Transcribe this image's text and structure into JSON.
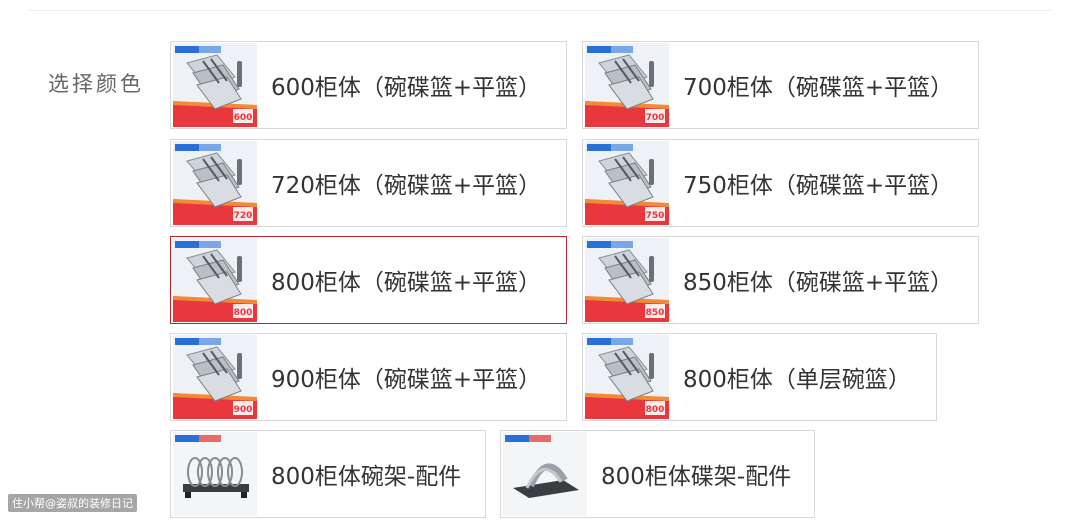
{
  "label": "选择颜色",
  "options": [
    {
      "text": "600柜体（碗碟篮+平篮）",
      "badge": "600",
      "kind": "cabinet",
      "selected": false
    },
    {
      "text": "700柜体（碗碟篮+平篮）",
      "badge": "700",
      "kind": "cabinet",
      "selected": false
    },
    {
      "text": "720柜体（碗碟篮+平篮）",
      "badge": "720",
      "kind": "cabinet",
      "selected": false
    },
    {
      "text": "750柜体（碗碟篮+平篮）",
      "badge": "750",
      "kind": "cabinet",
      "selected": false
    },
    {
      "text": "800柜体（碗碟篮+平篮）",
      "badge": "800",
      "kind": "cabinet",
      "selected": true
    },
    {
      "text": "850柜体（碗碟篮+平篮）",
      "badge": "850",
      "kind": "cabinet",
      "selected": false
    },
    {
      "text": "900柜体（碗碟篮+平篮）",
      "badge": "900",
      "kind": "cabinet",
      "selected": false
    },
    {
      "text": "800柜体（单层碗篮）",
      "badge": "800",
      "kind": "cabinet",
      "selected": false
    },
    {
      "text": "800柜体碗架-配件",
      "badge": "",
      "kind": "bowl-rack",
      "selected": false
    },
    {
      "text": "800柜体碟架-配件",
      "badge": "",
      "kind": "plate-rack",
      "selected": false
    }
  ],
  "watermark": "住小帮@姿叔的装修日记",
  "colors": {
    "selected_border": "#b8262c",
    "border": "#d8d8d8",
    "accent_red": "#e8383d",
    "accent_blue": "#2a6fd6"
  }
}
